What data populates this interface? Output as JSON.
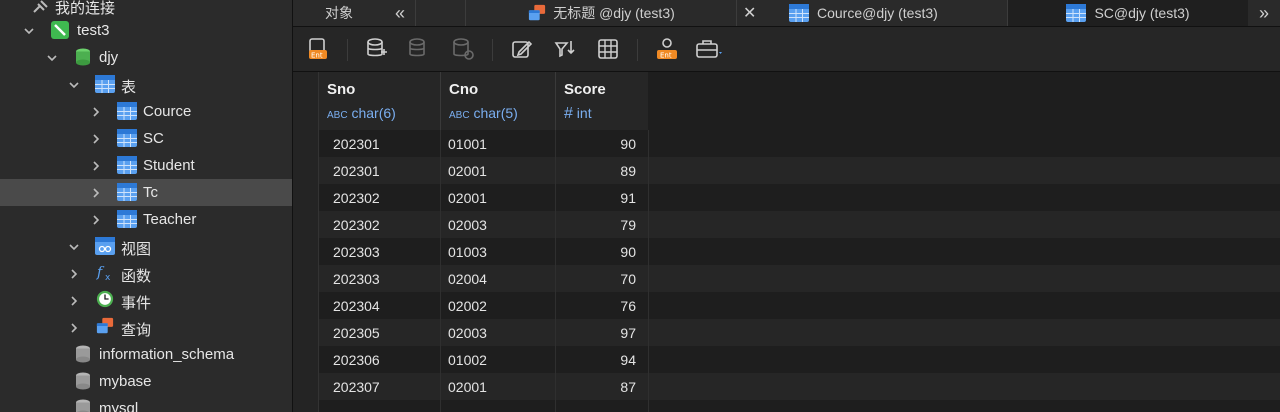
{
  "sidebar": {
    "connections_label": "我的连接",
    "connection": "test3",
    "database": "djy",
    "tables_group": "表",
    "tables": [
      "Cource",
      "SC",
      "Student",
      "Tc",
      "Teacher"
    ],
    "views_label": "视图",
    "functions_label": "函数",
    "events_label": "事件",
    "queries_label": "查询",
    "other_databases": [
      "information_schema",
      "mybase",
      "mysql"
    ]
  },
  "tabs": {
    "objects": "对象",
    "back": "«",
    "tab1": "无标题 @djy (test3)",
    "close": "✕",
    "tab2": "Cource@djy (test3)",
    "tab3": "SC@djy (test3)",
    "more": "»"
  },
  "toolbar": {
    "icons": [
      "ent-icon",
      "db-icon",
      "db-export-icon",
      "db-refresh-icon",
      "edit-icon",
      "filter-sort-icon",
      "grid-icon",
      "ent-user-icon",
      "toolbox-icon"
    ]
  },
  "grid": {
    "columns": [
      {
        "name": "Sno",
        "type": "char(6)",
        "type_prefix": "ABC"
      },
      {
        "name": "Cno",
        "type": "char(5)",
        "type_prefix": "ABC"
      },
      {
        "name": "Score",
        "type": "int",
        "type_prefix": "#"
      }
    ],
    "rows": [
      [
        "202301",
        "01001",
        "90"
      ],
      [
        "202301",
        "02001",
        "89"
      ],
      [
        "202302",
        "02001",
        "91"
      ],
      [
        "202302",
        "02003",
        "79"
      ],
      [
        "202303",
        "01003",
        "90"
      ],
      [
        "202303",
        "02004",
        "70"
      ],
      [
        "202304",
        "02002",
        "76"
      ],
      [
        "202305",
        "02003",
        "97"
      ],
      [
        "202306",
        "01002",
        "94"
      ],
      [
        "202307",
        "02001",
        "87"
      ]
    ]
  },
  "colors": {
    "accent_blue": "#5aa0f0",
    "db_green": "#4caf50",
    "connection_green": "#3fb950",
    "selected_row": "#4a4a4a"
  }
}
